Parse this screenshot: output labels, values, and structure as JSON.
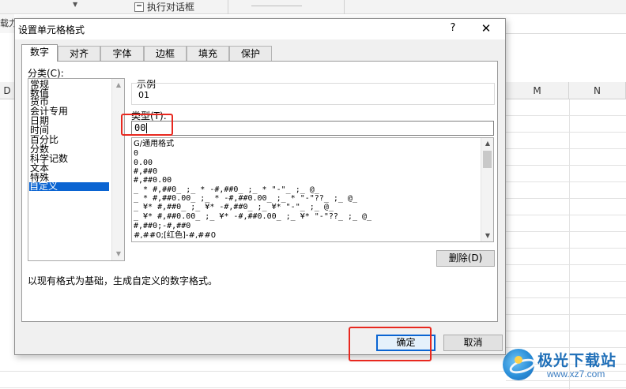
{
  "background": {
    "ribbon_button_label": "执行对话框",
    "left_fragment": "载力",
    "column_headers": [
      "D",
      "M",
      "N"
    ]
  },
  "dialog": {
    "title": "设置单元格格式",
    "help_glyph": "?",
    "close_glyph": "✕",
    "tabs": [
      {
        "label": "数字",
        "active": true
      },
      {
        "label": "对齐",
        "active": false
      },
      {
        "label": "字体",
        "active": false
      },
      {
        "label": "边框",
        "active": false
      },
      {
        "label": "填充",
        "active": false
      },
      {
        "label": "保护",
        "active": false
      }
    ],
    "category_label": "分类(C):",
    "categories": [
      "常规",
      "数值",
      "货币",
      "会计专用",
      "日期",
      "时间",
      "百分比",
      "分数",
      "科学记数",
      "文本",
      "特殊",
      "自定义"
    ],
    "selected_category": "自定义",
    "sample": {
      "label": "示例",
      "value": "01"
    },
    "type_label": "类型(T):",
    "type_value": "00",
    "format_codes": [
      "G/通用格式",
      "0",
      "0.00",
      "#,##0",
      "#,##0.00",
      "_ * #,##0_ ;_ * -#,##0_ ;_ * \"-\"_ ;_ @_",
      "_ * #,##0.00_ ;_ * -#,##0.00_ ;_ * \"-\"??_ ;_ @_",
      "_ ¥* #,##0_ ;_ ¥* -#,##0_ ;_ ¥* \"-\"_ ;_ @_",
      "_ ¥* #,##0.00_ ;_ ¥* -#,##0.00_ ;_ ¥* \"-\"??_ ;_ @_",
      "#,##0;-#,##0",
      "#,##0;[红色]-#,##0"
    ],
    "delete_button": "删除(D)",
    "description": "以现有格式为基础，生成自定义的数字格式。",
    "ok_button": "确定",
    "cancel_button": "取消"
  },
  "watermark": {
    "title": "极光下载站",
    "url": "www.xz7.com"
  },
  "colors": {
    "selection": "#0a64d2",
    "highlight_box": "#e8281f",
    "watermark_blue": "#1f6fb8"
  }
}
